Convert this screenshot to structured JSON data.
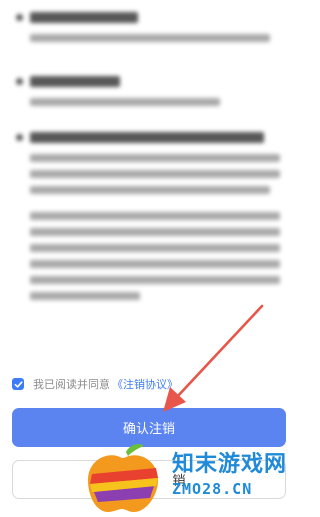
{
  "agreement": {
    "prefix": "我已阅读并同意",
    "link": "《注销协议》",
    "checked": true
  },
  "buttons": {
    "confirm_label": "确认注销",
    "cancel_label": "销"
  },
  "watermark": {
    "cn": "知末游戏网",
    "en": "ZMO28.CN"
  },
  "colors": {
    "accent": "#3e7bf6",
    "confirm_bg": "#5b84f0",
    "arrow": "#e8554a",
    "watermark": "#1f8ad8"
  }
}
